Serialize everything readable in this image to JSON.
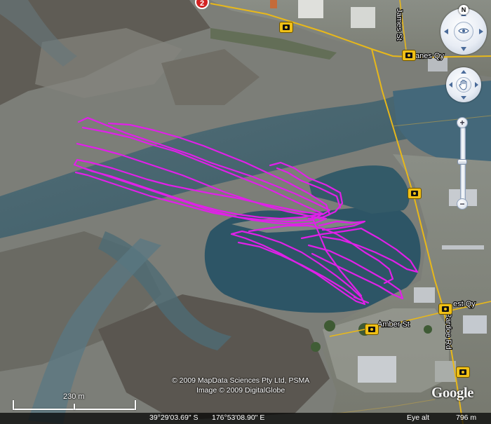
{
  "map": {
    "marker_number": "2",
    "track_color": "#e020e8",
    "road_color": "#e8b81a",
    "roads": {
      "james": "James St",
      "quay": "anes Qy",
      "west_quay": "est Qy",
      "amber": "Amber St",
      "pardoe": "Pardoe Rd"
    },
    "copyright": {
      "line1": "© 2009 MapData Sciences Pty Ltd, PSMA",
      "line2": "Image © 2009 DigitalGlobe"
    },
    "scale_label": "230 m",
    "north_label": "N",
    "zoom": {
      "in_label": "+",
      "out_label": "−",
      "level": 0.5
    },
    "status": {
      "latitude": "39°29'03.69\" S",
      "longitude": "176°53'08.90\" E",
      "eye_alt_label": "Eye alt",
      "eye_alt_value": "796 m"
    },
    "logo": "Google"
  }
}
